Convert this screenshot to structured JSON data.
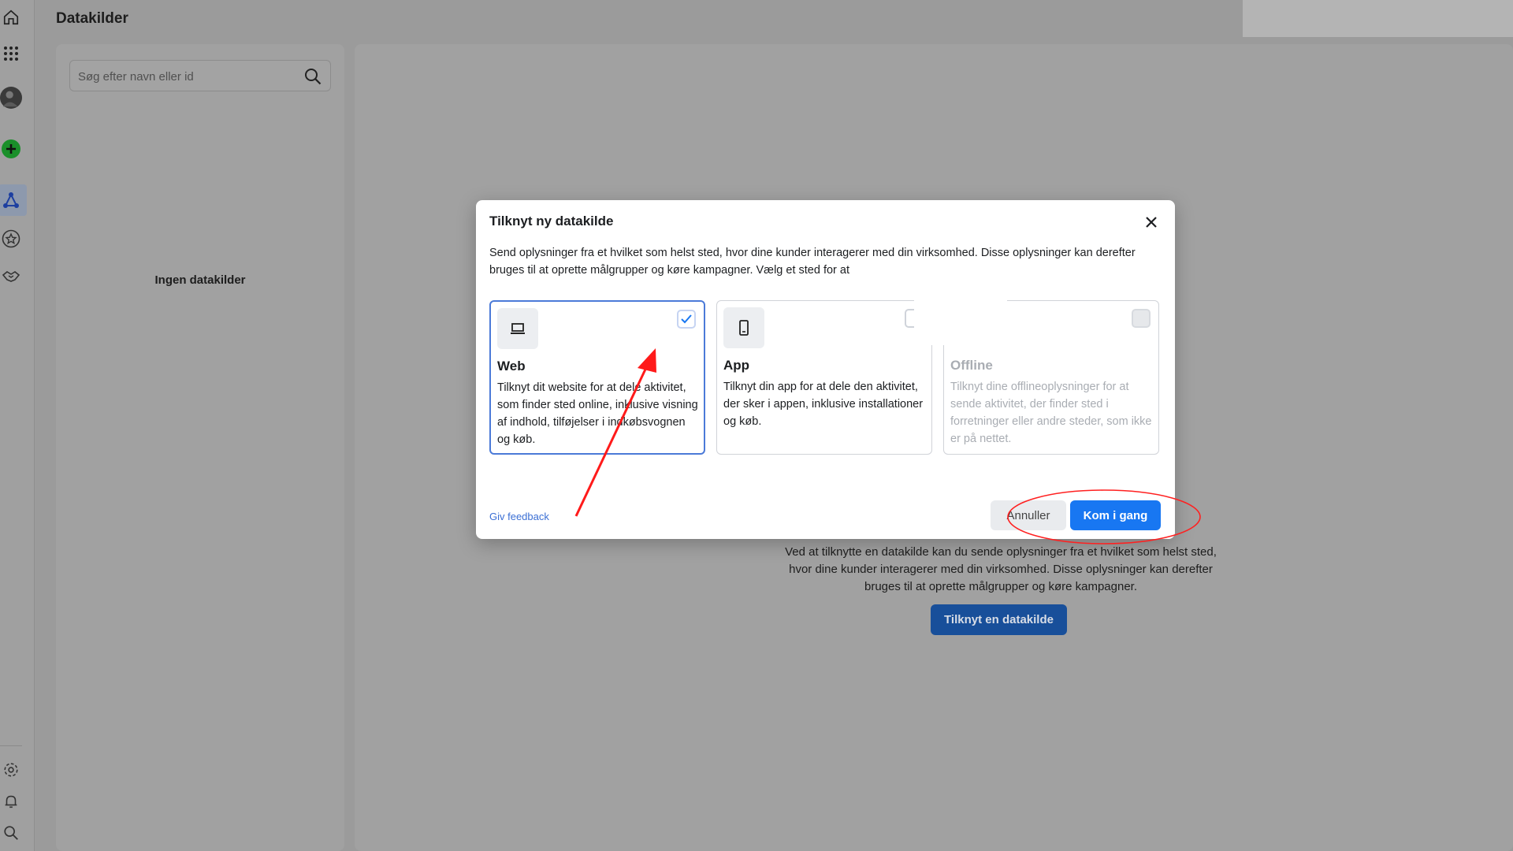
{
  "page": {
    "title": "Datakilder"
  },
  "sidebar": {
    "icons": [
      {
        "name": "home-icon"
      },
      {
        "name": "apps-grid-icon"
      },
      {
        "name": "avatar"
      },
      {
        "name": "add-icon"
      },
      {
        "name": "data-sources-icon"
      },
      {
        "name": "star-icon"
      },
      {
        "name": "handshake-icon"
      },
      {
        "name": "settings-icon"
      },
      {
        "name": "notifications-icon"
      },
      {
        "name": "search-icon"
      }
    ]
  },
  "left_panel": {
    "search_placeholder": "Søg efter navn eller id",
    "empty_label": "Ingen datakilder"
  },
  "main": {
    "description": "Ved at tilknytte en datakilde kan du sende oplysninger fra et hvilket som helst sted, hvor dine kunder interagerer med din virksomhed. Disse oplysninger kan derefter bruges til at oprette målgrupper og køre kampagner.",
    "cta_label": "Tilknyt en datakilde"
  },
  "modal": {
    "title": "Tilknyt ny datakilde",
    "description": "Send oplysninger fra et hvilket som helst sted, hvor dine kunder interagerer med din virksomhed. Disse oplysninger kan derefter bruges til at oprette målgrupper og køre kampagner. Vælg et sted for at",
    "options": [
      {
        "title": "Web",
        "description": "Tilknyt dit website for at dele aktivitet, som finder sted online, inklusive visning af indhold, tilføjelser i indkøbsvognen og køb.",
        "selected": true,
        "icon": "laptop-icon"
      },
      {
        "title": "App",
        "description": "Tilknyt din app for at dele den aktivitet, der sker i appen, inklusive installationer og køb.",
        "selected": false,
        "icon": "mobile-icon"
      },
      {
        "title": "Offline",
        "description": "Tilknyt dine offlineoplysninger for at sende aktivitet, der finder sted i forretninger eller andre steder, som ikke er på nettet.",
        "selected": false,
        "disabled": true,
        "icon": "store-icon"
      }
    ],
    "feedback_label": "Giv feedback",
    "cancel_label": "Annuller",
    "primary_label": "Kom i gang"
  },
  "colors": {
    "primary": "#1877f2",
    "selected_border": "#4b7ad8",
    "annotation": "#ff0000",
    "add_green": "#1a8f2a"
  }
}
